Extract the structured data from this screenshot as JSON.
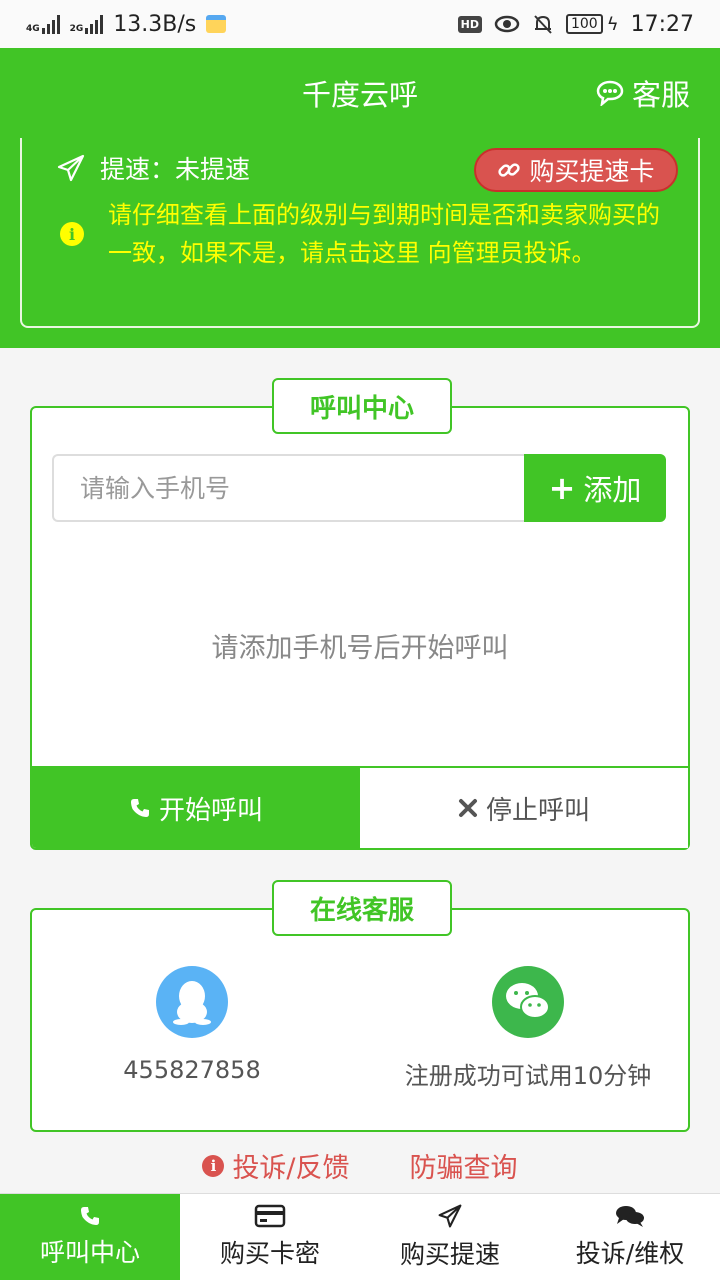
{
  "status_bar": {
    "net1": "4G",
    "net2": "2G",
    "speed": "13.3B/s",
    "hd": "HD",
    "battery": "100",
    "time": "17:27"
  },
  "header": {
    "title": "千度云呼",
    "service_label": "客服"
  },
  "info": {
    "speed_label": "提速：未提速",
    "buy_speed_label": "购买提速卡",
    "notice": "请仔细查看上面的级别与到期时间是否和卖家购买的一致，如果不是，请点击这里 向管理员投诉。"
  },
  "call_center": {
    "title": "呼叫中心",
    "phone_placeholder": "请输入手机号",
    "add_label": "添加",
    "empty_hint": "请添加手机号后开始呼叫",
    "start_label": "开始呼叫",
    "stop_label": "停止呼叫"
  },
  "online_service": {
    "title": "在线客服",
    "qq": "455827858",
    "wechat_note": "注册成功可试用10分钟"
  },
  "links": {
    "complaint": "投诉/反馈",
    "anti_fraud": "防骗查询"
  },
  "nav": [
    {
      "label": "呼叫中心",
      "icon": "phone-icon",
      "active": true
    },
    {
      "label": "购买卡密",
      "icon": "credit-card-icon",
      "active": false
    },
    {
      "label": "购买提速",
      "icon": "paper-plane-icon",
      "active": false
    },
    {
      "label": "投诉/维权",
      "icon": "comments-icon",
      "active": false
    }
  ],
  "colors": {
    "primary_green": "#41c526",
    "notice_yellow": "#ffff00",
    "danger_red": "#d9534f"
  }
}
